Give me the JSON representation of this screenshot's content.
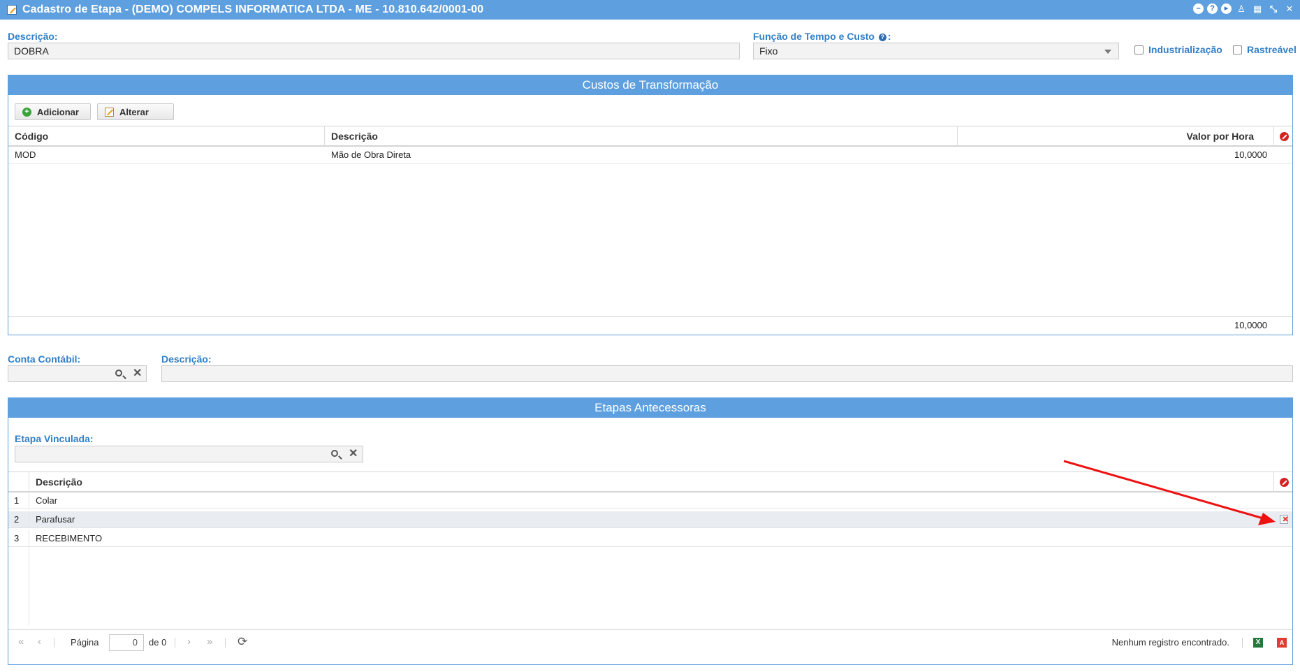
{
  "window": {
    "title": "Cadastro de Etapa - (DEMO) COMPELS INFORMATICA LTDA - ME - 10.810.642/0001-00",
    "buttons": [
      "minimize-icon",
      "help-icon",
      "play-icon",
      "user-icon",
      "calendar-icon",
      "compress-icon",
      "close-icon"
    ]
  },
  "form": {
    "descricao_label": "Descrição:",
    "descricao_value": "DOBRA",
    "funcao_label": "Função de Tempo e Custo",
    "funcao_value": "Fixo",
    "industrializacao_label": "Industrialização",
    "rastreavel_label": "Rastreável"
  },
  "custos": {
    "title": "Custos de Transformação",
    "add_label": "Adicionar",
    "edit_label": "Alterar",
    "columns": [
      "Código",
      "Descrição",
      "Valor por Hora"
    ],
    "rows": [
      {
        "codigo": "MOD",
        "descricao": "Mão de Obra Direta",
        "valor": "10,0000"
      }
    ],
    "total": "10,0000"
  },
  "conta": {
    "conta_label": "Conta Contábil:",
    "conta_value": "",
    "descricao_label": "Descrição:",
    "descricao_value": ""
  },
  "etapas": {
    "title": "Etapas Antecessoras",
    "vinculada_label": "Etapa Vinculada:",
    "vinculada_value": "",
    "column": "Descrição",
    "rows": [
      {
        "n": "1",
        "descricao": "Colar"
      },
      {
        "n": "2",
        "descricao": "Parafusar"
      },
      {
        "n": "3",
        "descricao": "RECEBIMENTO"
      }
    ]
  },
  "pager": {
    "page_label": "Página",
    "page_value": "0",
    "of_label": "de 0",
    "status": "Nenhum registro encontrado."
  },
  "colors": {
    "accent": "#5d9fdf",
    "label": "#2f7fc8",
    "annotation_arrow": "#ee1111"
  }
}
